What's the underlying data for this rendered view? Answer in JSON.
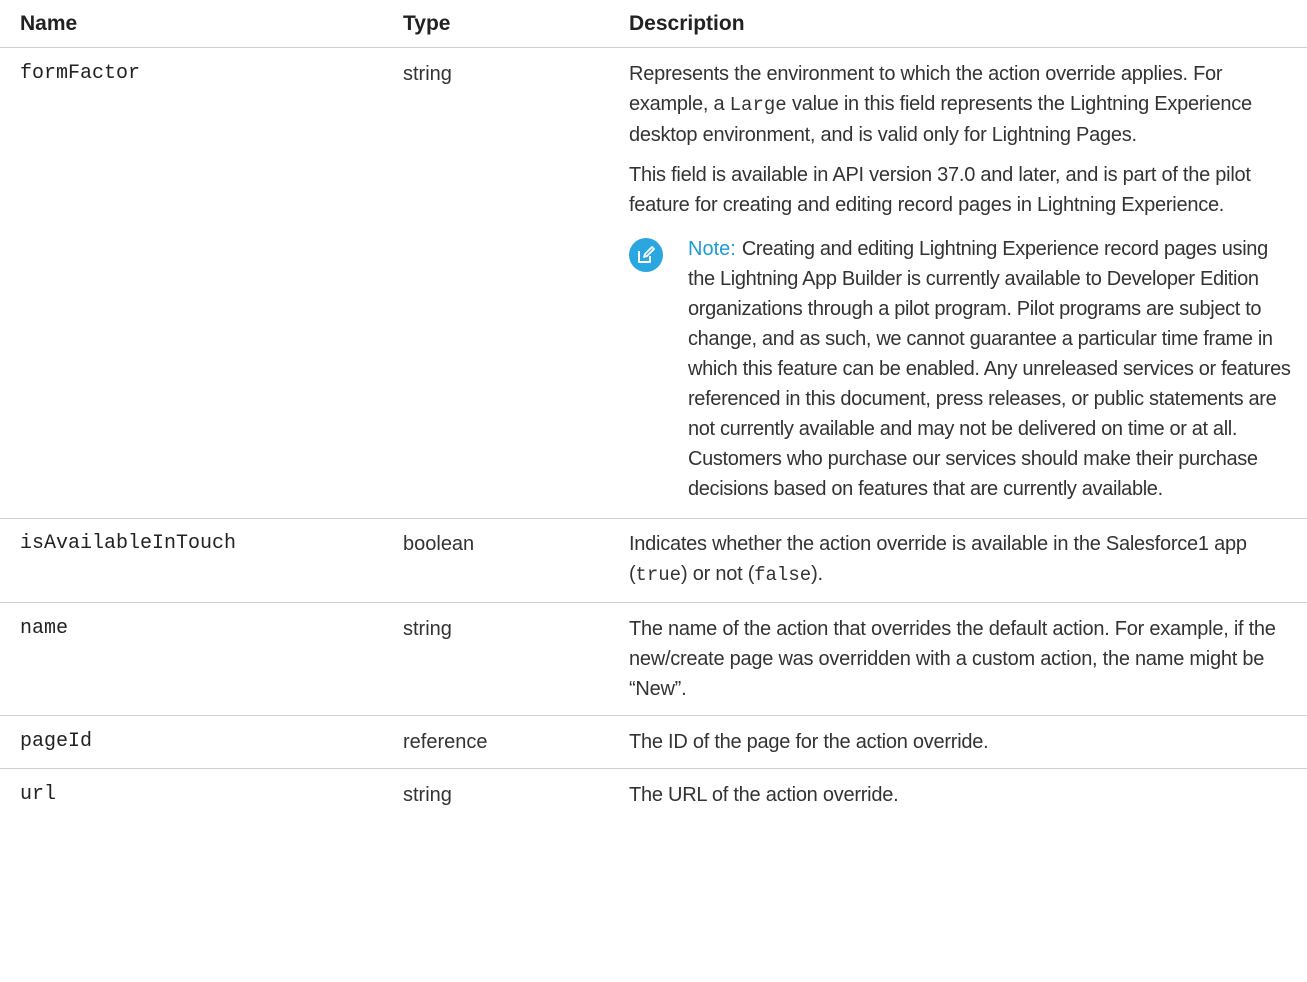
{
  "headers": {
    "name": "Name",
    "type": "Type",
    "description": "Description"
  },
  "rows": [
    {
      "name": "formFactor",
      "type": "string",
      "desc_p1_a": "Represents the environment to which the action override applies. For example, a ",
      "desc_p1_code": "Large",
      "desc_p1_b": " value in this field represents the Lightning Experience desktop environment, and is valid only for Lightning Pages.",
      "desc_p2": "This field is available in API version 37.0 and later, and is part of the pilot feature for creating and editing record pages in Lightning Experience.",
      "note_label": "Note:",
      "note_text": "Creating and editing Lightning Experience record pages using the Lightning App Builder is currently available to Developer Edition organizations through a pilot program. Pilot programs are subject to change, and as such, we cannot guarantee a particular time frame in which this feature can be enabled. Any unreleased services or features referenced in this document, press releases, or public statements are not currently available and may not be delivered on time or at all. Customers who purchase our services should make their purchase decisions based on features that are currently available."
    },
    {
      "name": "isAvailableInTouch",
      "type": "boolean",
      "desc_a": "Indicates whether the action override is available in the Salesforce1 app (",
      "desc_code1": "true",
      "desc_b": ") or not (",
      "desc_code2": "false",
      "desc_c": ")."
    },
    {
      "name": "name",
      "type": "string",
      "desc": "The name of the action that overrides the default action. For example, if the new/create page was overridden with a custom action, the name might be “New”."
    },
    {
      "name": "pageId",
      "type": "reference",
      "desc": "The ID of the page for the action override."
    },
    {
      "name": "url",
      "type": "string",
      "desc": "The URL of the action override."
    }
  ],
  "icons": {
    "note": "edit-note-icon"
  },
  "colors": {
    "note_accent": "#1e9bd7",
    "note_icon_bg": "#2aa6e0",
    "divider": "#cfcfcf"
  }
}
